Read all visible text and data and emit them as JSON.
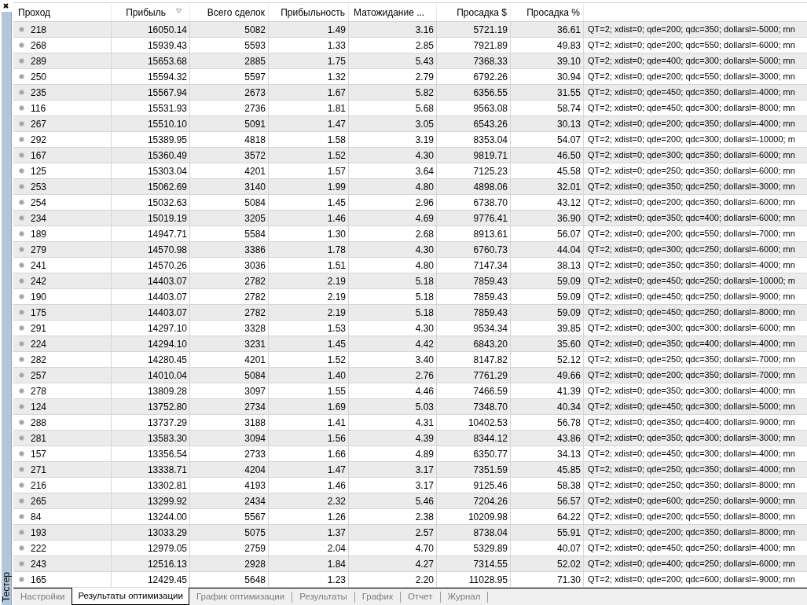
{
  "panel": {
    "title": "Тестер"
  },
  "table": {
    "columns": [
      {
        "label": "Проход",
        "sorted": false
      },
      {
        "label": "Прибыль",
        "sorted": true
      },
      {
        "label": "Всего сделок",
        "sorted": false
      },
      {
        "label": "Прибыльность",
        "sorted": false
      },
      {
        "label": "Матожидание ...",
        "sorted": false
      },
      {
        "label": "Просадка $",
        "sorted": false
      },
      {
        "label": "Просадка %",
        "sorted": false
      }
    ],
    "rows": [
      {
        "cells": [
          "218",
          "16050.14",
          "5082",
          "1.49",
          "3.16",
          "5721.19",
          "36.61",
          "QT=2; xdist=0; qde=200; qdc=350; dollarsl=-5000; mn"
        ]
      },
      {
        "cells": [
          "268",
          "15939.43",
          "5593",
          "1.33",
          "2.85",
          "7921.89",
          "49.83",
          "QT=2; xdist=0; qde=200; qdc=550; dollarsl=-6000; mn"
        ]
      },
      {
        "cells": [
          "289",
          "15653.68",
          "2885",
          "1.75",
          "5.43",
          "7368.33",
          "39.10",
          "QT=2; xdist=0; qde=400; qdc=300; dollarsl=-5000; mn"
        ]
      },
      {
        "cells": [
          "250",
          "15594.32",
          "5597",
          "1.32",
          "2.79",
          "6792.26",
          "30.94",
          "QT=2; xdist=0; qde=200; qdc=550; dollarsl=-3000; mn"
        ]
      },
      {
        "cells": [
          "235",
          "15567.94",
          "2673",
          "1.67",
          "5.82",
          "6356.55",
          "31.55",
          "QT=2; xdist=0; qde=450; qdc=350; dollarsl=-4000; mn"
        ]
      },
      {
        "cells": [
          "116",
          "15531.93",
          "2736",
          "1.81",
          "5.68",
          "9563.08",
          "58.74",
          "QT=2; xdist=0; qde=450; qdc=300; dollarsl=-8000; mn"
        ]
      },
      {
        "cells": [
          "267",
          "15510.10",
          "5091",
          "1.47",
          "3.05",
          "6543.26",
          "30.13",
          "QT=2; xdist=0; qde=200; qdc=350; dollarsl=-4000; mn"
        ]
      },
      {
        "cells": [
          "292",
          "15389.95",
          "4818",
          "1.58",
          "3.19",
          "8353.04",
          "54.07",
          "QT=2; xdist=0; qde=200; qdc=300; dollarsl=-10000; m"
        ]
      },
      {
        "cells": [
          "167",
          "15360.49",
          "3572",
          "1.52",
          "4.30",
          "9819.71",
          "46.50",
          "QT=2; xdist=0; qde=300; qdc=350; dollarsl=-6000; mn"
        ]
      },
      {
        "cells": [
          "125",
          "15303.04",
          "4201",
          "1.57",
          "3.64",
          "7125.23",
          "45.58",
          "QT=2; xdist=0; qde=250; qdc=350; dollarsl=-6000; mn"
        ]
      },
      {
        "cells": [
          "253",
          "15062.69",
          "3140",
          "1.99",
          "4.80",
          "4898.06",
          "32.01",
          "QT=2; xdist=0; qde=350; qdc=250; dollarsl=-3000; mn"
        ]
      },
      {
        "cells": [
          "254",
          "15032.63",
          "5084",
          "1.45",
          "2.96",
          "6738.70",
          "43.12",
          "QT=2; xdist=0; qde=200; qdc=350; dollarsl=-6000; mn"
        ]
      },
      {
        "cells": [
          "234",
          "15019.19",
          "3205",
          "1.46",
          "4.69",
          "9776.41",
          "36.90",
          "QT=2; xdist=0; qde=350; qdc=400; dollarsl=-6000; mn"
        ]
      },
      {
        "cells": [
          "189",
          "14947.71",
          "5584",
          "1.30",
          "2.68",
          "8913.61",
          "56.07",
          "QT=2; xdist=0; qde=200; qdc=550; dollarsl=-7000; mn"
        ]
      },
      {
        "cells": [
          "279",
          "14570.98",
          "3386",
          "1.78",
          "4.30",
          "6760.73",
          "44.04",
          "QT=2; xdist=0; qde=300; qdc=250; dollarsl=-6000; mn"
        ]
      },
      {
        "cells": [
          "241",
          "14570.26",
          "3036",
          "1.51",
          "4.80",
          "7147.34",
          "38.13",
          "QT=2; xdist=0; qde=350; qdc=350; dollarsl=-4000; mn"
        ]
      },
      {
        "cells": [
          "242",
          "14403.07",
          "2782",
          "2.19",
          "5.18",
          "7859.43",
          "59.09",
          "QT=2; xdist=0; qde=450; qdc=250; dollarsl=-10000; m"
        ]
      },
      {
        "cells": [
          "190",
          "14403.07",
          "2782",
          "2.19",
          "5.18",
          "7859.43",
          "59.09",
          "QT=2; xdist=0; qde=450; qdc=250; dollarsl=-9000; mn"
        ]
      },
      {
        "cells": [
          "175",
          "14403.07",
          "2782",
          "2.19",
          "5.18",
          "7859.43",
          "59.09",
          "QT=2; xdist=0; qde=450; qdc=250; dollarsl=-8000; mn"
        ]
      },
      {
        "cells": [
          "291",
          "14297.10",
          "3328",
          "1.53",
          "4.30",
          "9534.34",
          "39.85",
          "QT=2; xdist=0; qde=300; qdc=300; dollarsl=-6000; mn"
        ]
      },
      {
        "cells": [
          "224",
          "14294.10",
          "3231",
          "1.45",
          "4.42",
          "6843.20",
          "35.60",
          "QT=2; xdist=0; qde=350; qdc=400; dollarsl=-4000; mn"
        ]
      },
      {
        "cells": [
          "282",
          "14280.45",
          "4201",
          "1.52",
          "3.40",
          "8147.82",
          "52.12",
          "QT=2; xdist=0; qde=250; qdc=350; dollarsl=-7000; mn"
        ]
      },
      {
        "cells": [
          "257",
          "14010.04",
          "5084",
          "1.40",
          "2.76",
          "7761.29",
          "49.66",
          "QT=2; xdist=0; qde=200; qdc=350; dollarsl=-7000; mn"
        ]
      },
      {
        "cells": [
          "278",
          "13809.28",
          "3097",
          "1.55",
          "4.46",
          "7466.59",
          "41.39",
          "QT=2; xdist=0; qde=350; qdc=300; dollarsl=-4000; mn"
        ]
      },
      {
        "cells": [
          "124",
          "13752.80",
          "2734",
          "1.69",
          "5.03",
          "7348.70",
          "40.34",
          "QT=2; xdist=0; qde=450; qdc=300; dollarsl=-5000; mn"
        ]
      },
      {
        "cells": [
          "288",
          "13737.29",
          "3188",
          "1.41",
          "4.31",
          "10402.53",
          "56.78",
          "QT=2; xdist=0; qde=350; qdc=400; dollarsl=-9000; mn"
        ]
      },
      {
        "cells": [
          "281",
          "13583.30",
          "3094",
          "1.56",
          "4.39",
          "8344.12",
          "43.86",
          "QT=2; xdist=0; qde=350; qdc=300; dollarsl=-3000; mn"
        ]
      },
      {
        "cells": [
          "157",
          "13356.54",
          "2733",
          "1.66",
          "4.89",
          "6350.77",
          "34.13",
          "QT=2; xdist=0; qde=450; qdc=300; dollarsl=-4000; mn"
        ]
      },
      {
        "cells": [
          "271",
          "13338.71",
          "4204",
          "1.47",
          "3.17",
          "7351.59",
          "45.85",
          "QT=2; xdist=0; qde=250; qdc=350; dollarsl=-4000; mn"
        ]
      },
      {
        "cells": [
          "216",
          "13302.81",
          "4193",
          "1.46",
          "3.17",
          "9125.46",
          "58.38",
          "QT=2; xdist=0; qde=250; qdc=350; dollarsl=-8000; mn"
        ]
      },
      {
        "cells": [
          "265",
          "13299.92",
          "2434",
          "2.32",
          "5.46",
          "7204.26",
          "56.57",
          "QT=2; xdist=0; qde=600; qdc=250; dollarsl=-9000; mn"
        ]
      },
      {
        "cells": [
          "84",
          "13244.00",
          "5567",
          "1.26",
          "2.38",
          "10209.98",
          "64.22",
          "QT=2; xdist=0; qde=200; qdc=550; dollarsl=-8000; mn"
        ]
      },
      {
        "cells": [
          "193",
          "13033.29",
          "5075",
          "1.37",
          "2.57",
          "8738.04",
          "55.91",
          "QT=2; xdist=0; qde=200; qdc=350; dollarsl=-8000; mn"
        ]
      },
      {
        "cells": [
          "222",
          "12979.05",
          "2759",
          "2.04",
          "4.70",
          "5329.89",
          "40.07",
          "QT=2; xdist=0; qde=450; qdc=250; dollarsl=-4000; mn"
        ]
      },
      {
        "cells": [
          "243",
          "12516.13",
          "2928",
          "1.84",
          "4.27",
          "7314.55",
          "52.02",
          "QT=2; xdist=0; qde=400; qdc=250; dollarsl=-6000; mn"
        ]
      },
      {
        "cells": [
          "165",
          "12429.45",
          "5648",
          "1.23",
          "2.20",
          "11028.95",
          "71.30",
          "QT=2; xdist=0; qde=200; qdc=600; dollarsl=-9000; mn"
        ]
      }
    ]
  },
  "tabs": [
    {
      "label": "Настройки",
      "selected": false
    },
    {
      "label": "Результаты оптимизации",
      "selected": true
    },
    {
      "label": "График оптимизации",
      "selected": false
    },
    {
      "label": "Результаты",
      "selected": false
    },
    {
      "label": "График",
      "selected": false
    },
    {
      "label": "Отчет",
      "selected": false
    },
    {
      "label": "Журнал",
      "selected": false
    }
  ]
}
